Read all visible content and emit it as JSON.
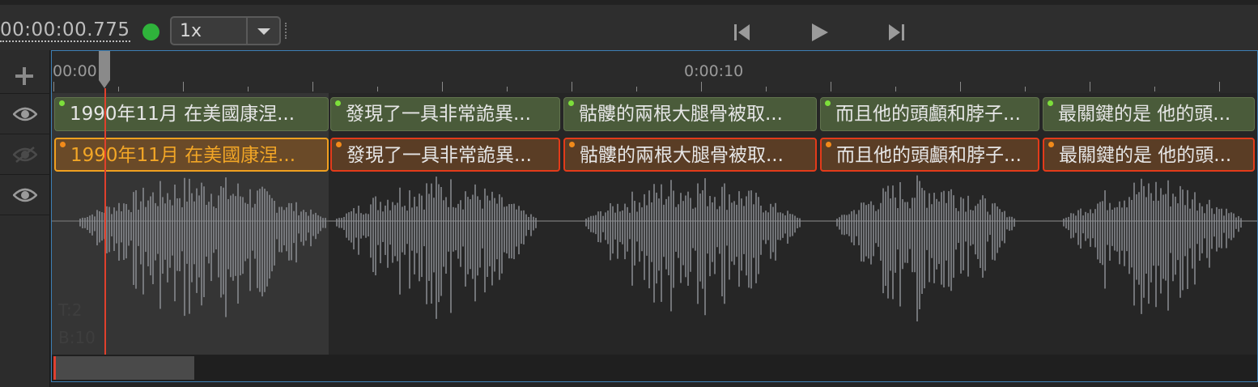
{
  "toolbar": {
    "timecode": "00:00:00.775",
    "speed_value": "1x",
    "status_color": "#2fb33b",
    "prev_icon": "skip-previous-icon",
    "play_icon": "play-icon",
    "next_icon": "skip-next-icon"
  },
  "ruler": {
    "labels": [
      "00:00",
      "0:00:10"
    ]
  },
  "track_header": {
    "add_icon": "plus-icon",
    "row_icons": [
      "eye-icon",
      "eye-off-icon",
      "eye-icon"
    ]
  },
  "subtitle_rows": [
    {
      "blocks": [
        {
          "text": "1990年11月 在美國康涅..."
        },
        {
          "text": "發現了一具非常詭異..."
        },
        {
          "text": "骷髏的兩根大腿骨被取..."
        },
        {
          "text": "而且他的頭顱和脖子..."
        },
        {
          "text": "最關鍵的是 他的頭..."
        }
      ]
    },
    {
      "blocks": [
        {
          "text": "1990年11月 在美國康涅..."
        },
        {
          "text": "發現了一具非常詭異..."
        },
        {
          "text": "骷髏的兩根大腿骨被取..."
        },
        {
          "text": "而且他的頭顱和脖子..."
        },
        {
          "text": "最關鍵的是 他的頭..."
        }
      ]
    }
  ],
  "waveform_info": {
    "t": "T:2",
    "b": "B:10"
  },
  "colors": {
    "accent_border": "#3d7fb5",
    "playhead": "#e0402c",
    "selected_text": "#f2a626"
  }
}
